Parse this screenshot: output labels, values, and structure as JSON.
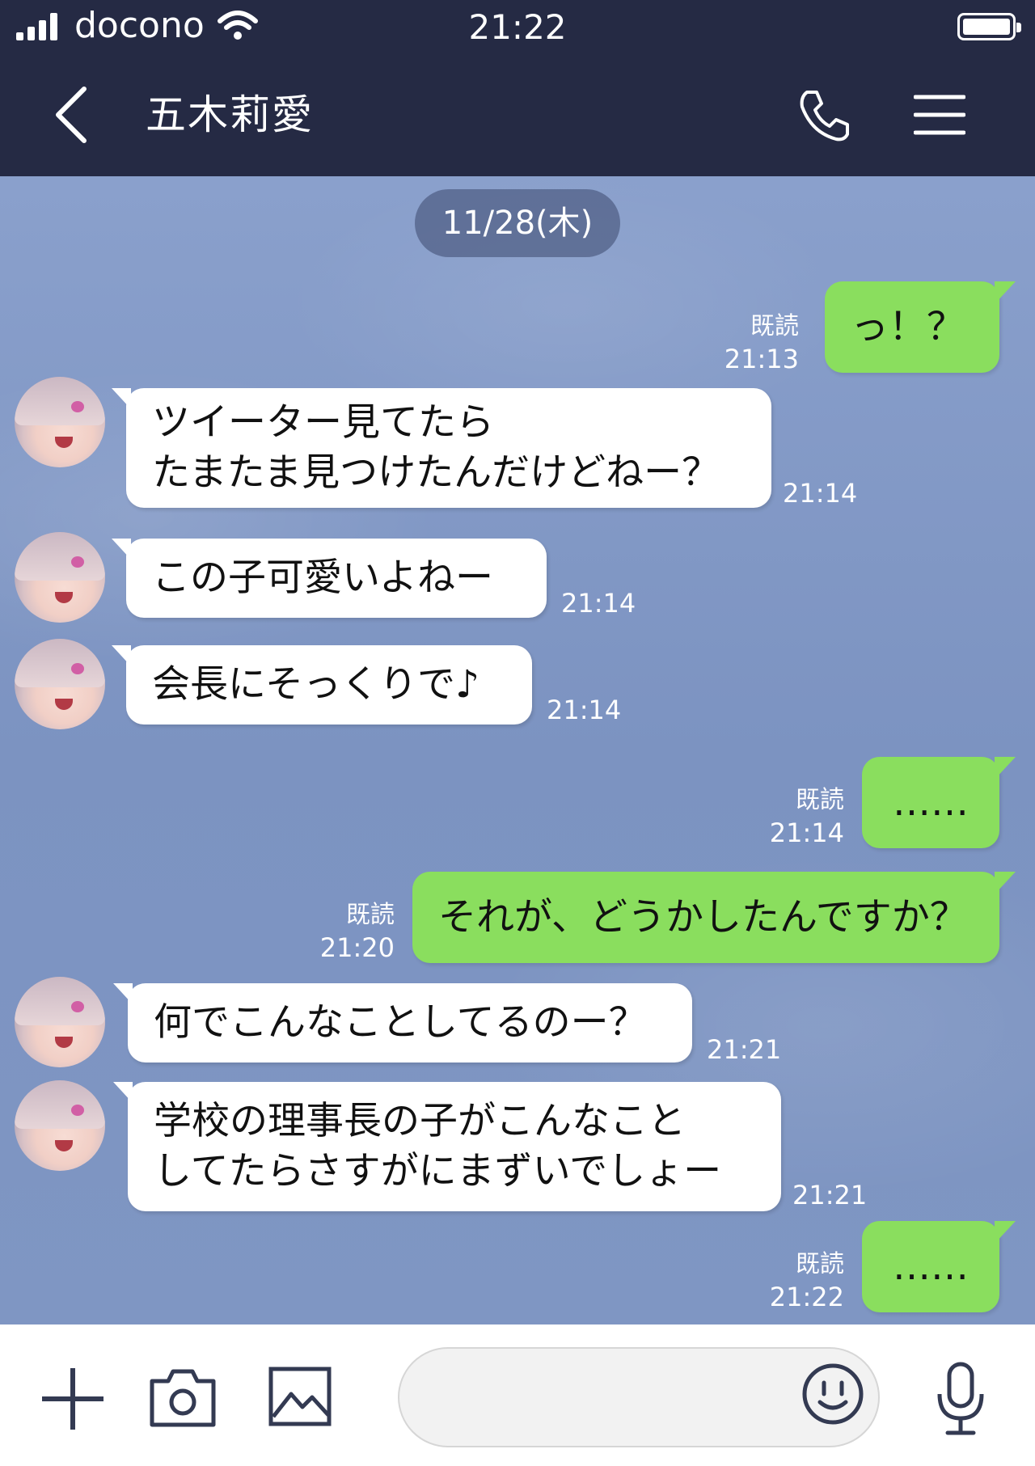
{
  "status_bar": {
    "carrier": "docono",
    "time": "21:22",
    "signal_icon": "signal-bars-icon",
    "wifi_icon": "wifi-icon",
    "battery_icon": "battery-icon"
  },
  "header": {
    "contact_name": "五木莉愛",
    "back_icon": "chevron-left-icon",
    "call_icon": "phone-icon",
    "menu_icon": "hamburger-menu-icon"
  },
  "chat": {
    "date": "11/28(木)",
    "messages": [
      {
        "side": "out",
        "lines": [
          "っ！？"
        ],
        "read": "既読",
        "time": "21:13"
      },
      {
        "side": "in",
        "lines": [
          "ツイーター見てたら",
          "たまたま見つけたんだけどねー？"
        ],
        "time": "21:14"
      },
      {
        "side": "in",
        "lines": [
          "この子可愛いよねー"
        ],
        "time": "21:14"
      },
      {
        "side": "in",
        "lines": [
          "会長にそっくりで♪"
        ],
        "time": "21:14"
      },
      {
        "side": "out",
        "lines": [
          "……"
        ],
        "read": "既読",
        "time": "21:14"
      },
      {
        "side": "out",
        "lines": [
          "それが、どうかしたんですか？"
        ],
        "read": "既読",
        "time": "21:20"
      },
      {
        "side": "in",
        "lines": [
          "何でこんなことしてるのー？"
        ],
        "time": "21:21"
      },
      {
        "side": "in",
        "lines": [
          "学校の理事長の子がこんなこと",
          "してたらさすがにまずいでしょー"
        ],
        "time": "21:21"
      },
      {
        "side": "out",
        "lines": [
          "……"
        ],
        "read": "既読",
        "time": "21:22"
      }
    ]
  },
  "input_bar": {
    "plus_icon": "plus-icon",
    "camera_icon": "camera-icon",
    "image_icon": "image-icon",
    "emoji_icon": "smiley-icon",
    "mic_icon": "microphone-icon",
    "message_value": ""
  },
  "colors": {
    "header_bg": "#252a44",
    "chat_bg": "#7f96c2",
    "bubble_out": "#8ade5e",
    "bubble_in": "#ffffff"
  }
}
